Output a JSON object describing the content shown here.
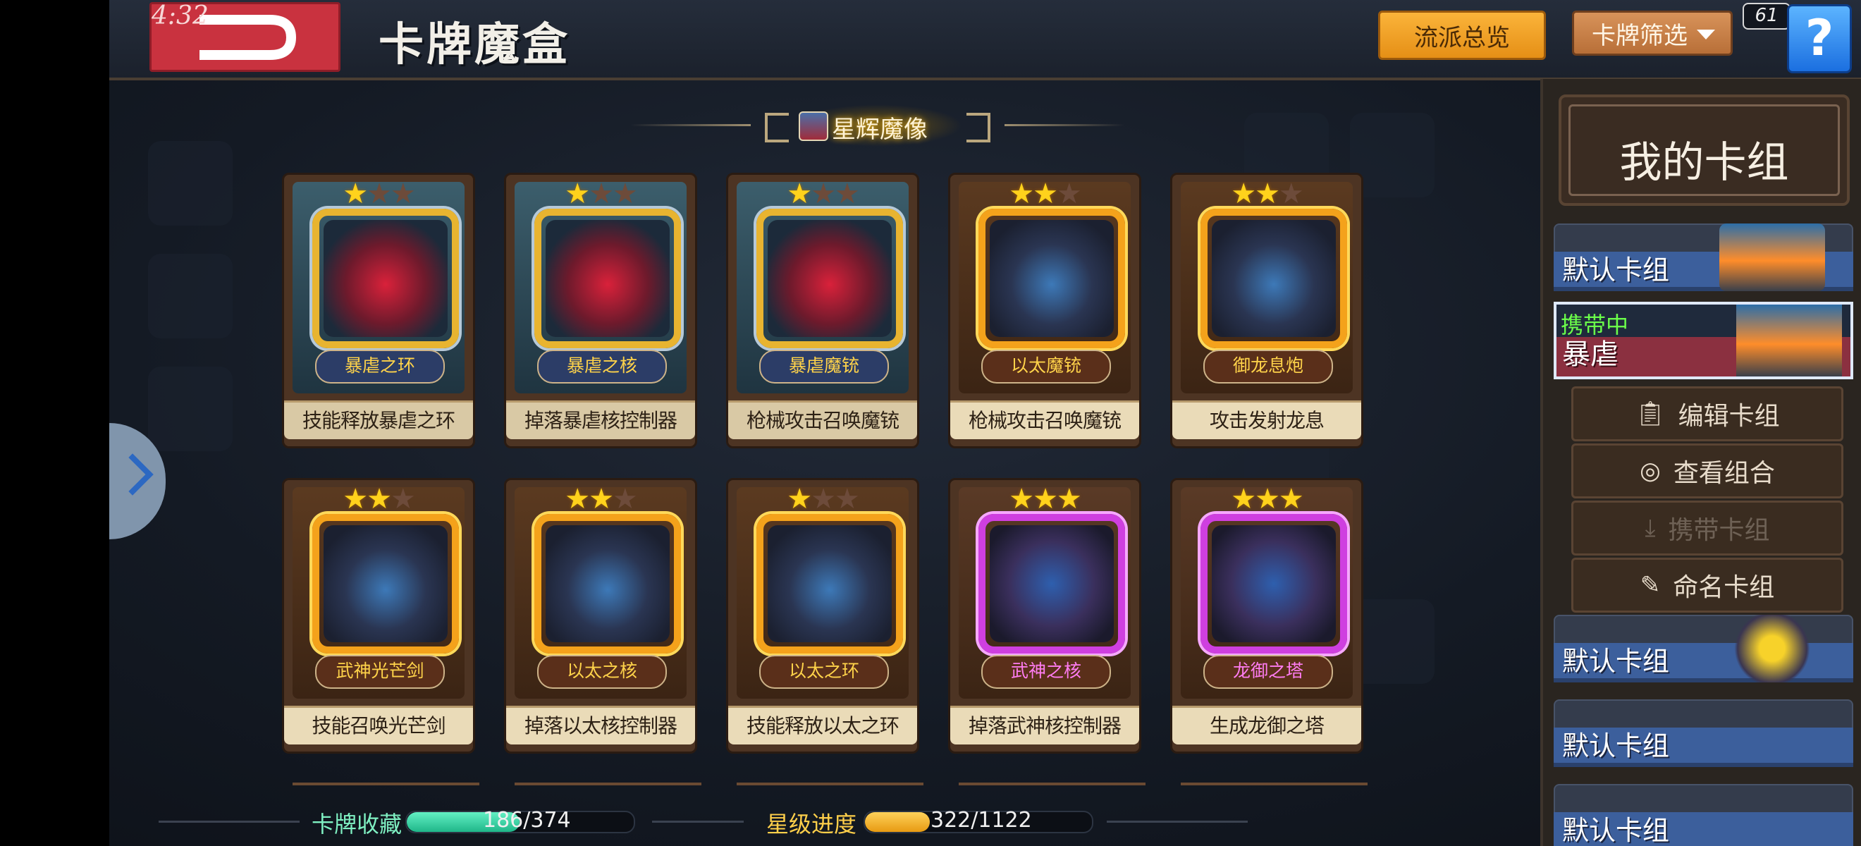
{
  "status": {
    "clock": "4:32",
    "fps": "61"
  },
  "header": {
    "title": "卡牌魔盒",
    "overview_label": "流派总览",
    "filter_label": "卡牌筛选",
    "help_label": "?"
  },
  "section": {
    "title": "星辉魔像"
  },
  "cards": [
    {
      "name": "暴虐之环",
      "desc": "技能释放暴虐之环",
      "stars": 1,
      "rarity": "blue"
    },
    {
      "name": "暴虐之核",
      "desc": "掉落暴虐核控制器",
      "stars": 1,
      "rarity": "blue"
    },
    {
      "name": "暴虐魔铳",
      "desc": "枪械攻击召唤魔铳",
      "stars": 1,
      "rarity": "blue"
    },
    {
      "name": "以太魔铳",
      "desc": "枪械攻击召唤魔铳",
      "stars": 2,
      "rarity": "gold"
    },
    {
      "name": "御龙息炮",
      "desc": "攻击发射龙息",
      "stars": 2,
      "rarity": "gold"
    },
    {
      "name": "武神光芒剑",
      "desc": "技能召唤光芒剑",
      "stars": 2,
      "rarity": "gold"
    },
    {
      "name": "以太之核",
      "desc": "掉落以太核控制器",
      "stars": 2,
      "rarity": "gold"
    },
    {
      "name": "以太之环",
      "desc": "技能释放以太之环",
      "stars": 1,
      "rarity": "gold"
    },
    {
      "name": "武神之核",
      "desc": "掉落武神核控制器",
      "stars": 3,
      "rarity": "purple"
    },
    {
      "name": "龙御之塔",
      "desc": "生成龙御之塔",
      "stars": 3,
      "rarity": "purple"
    }
  ],
  "stats": {
    "collection_label": "卡牌收藏",
    "collection_text": "186/374",
    "collection_fraction": 0.497,
    "stars_label": "星级进度",
    "stars_text": "322/1122",
    "stars_fraction": 0.287
  },
  "deck_panel": {
    "title": "我的卡组",
    "decks": [
      {
        "name": "默认卡组"
      },
      {
        "name": "暴虐",
        "tag": "携带中",
        "active": true
      },
      {
        "name": "默认卡组"
      },
      {
        "name": "默认卡组"
      },
      {
        "name": "默认卡组"
      }
    ],
    "actions": [
      {
        "label": "编辑卡组",
        "icon": "clipboard-icon",
        "enabled": true
      },
      {
        "label": "查看组合",
        "icon": "eye-icon",
        "enabled": true
      },
      {
        "label": "携带卡组",
        "icon": "download-icon",
        "enabled": false
      },
      {
        "label": "命名卡组",
        "icon": "pencil-icon",
        "enabled": true
      }
    ]
  },
  "colors": {
    "accent_orange": "#f5a623",
    "back_red": "#c9323f",
    "collection_green": "#3fd9a8",
    "stars_gold": "#f0b02a",
    "active_green": "#6bff4a"
  }
}
